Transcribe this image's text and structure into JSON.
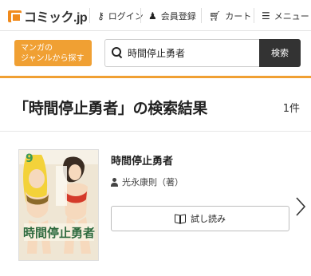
{
  "header": {
    "logo_text": "コミック.jp",
    "nav": {
      "login": "ログイン",
      "register": "会員登録",
      "cart": "カート",
      "menu": "メニュー"
    }
  },
  "search": {
    "genre_button_line1": "マンガの",
    "genre_button_line2": "ジャンルから探す",
    "query": "時間停止勇者",
    "button_label": "検索"
  },
  "results": {
    "heading": "「時間停止勇者」の検索結果",
    "count": "1件",
    "items": [
      {
        "title": "時間停止勇者",
        "author": "光永康則（著）",
        "trial_label": "試し読み",
        "cover_volume": "9",
        "cover_title": "時間停止勇者"
      }
    ]
  },
  "colors": {
    "accent": "#f0a033",
    "search_button": "#333333",
    "text": "#222222"
  }
}
